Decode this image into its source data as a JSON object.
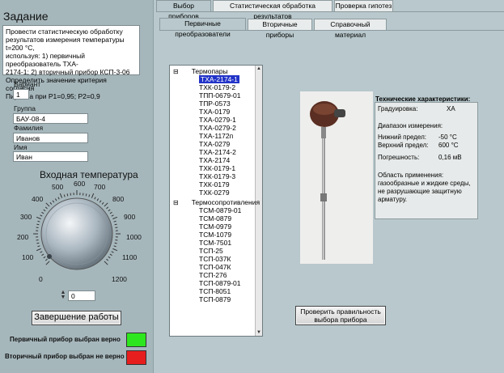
{
  "left": {
    "task_title": "Задание",
    "task_text": "Провести статистическую обработку\nрезультатов измерения температуры t=200 °С,\nиспользуя: 1) первичный преобразователь ТХА-\n2174-1; 2) вторичный прибор КСП-3-06\nОпределить значение критерия согласия\nПирсона при Р1=0,95; Р2=0,9",
    "variant_label": "Вариант",
    "variant_value": "1",
    "group_label": "Группа",
    "group_value": "БАУ-08-4",
    "surname_label": "Фамилия",
    "surname_value": "Иванов",
    "name_label": "Имя",
    "name_value": "Иван",
    "knob_title": "Входная температура",
    "knob_ticks": [
      "0",
      "100",
      "200",
      "300",
      "400",
      "500",
      "600",
      "700",
      "800",
      "900",
      "1000",
      "1100",
      "1200"
    ],
    "knob_value": "0",
    "finish_button": "Завершение работы",
    "status1": "Первичный прибор выбран верно",
    "status1_color": "#2ee61e",
    "status2": "Вторичный прибор выбран не верно",
    "status2_color": "#e61e1e"
  },
  "tabs": [
    "Выбор приборов",
    "Статистическая обработка результатов",
    "Проверка гипотез"
  ],
  "subtabs": [
    "Первичные преобразователи",
    "Вторичные приборы",
    "Справочный материал"
  ],
  "tree": {
    "group1": "Термопары",
    "group1_items": [
      "ТХА-2174-1",
      "ТХК-0179-2",
      "ТПП-0679-01",
      "ТПР-0573",
      "ТХА-0179",
      "ТХА-0279-1",
      "ТХА-0279-2",
      "ТХА-1172п",
      "ТХА-0279",
      "ТХА-2174-2",
      "ТХА-2174",
      "ТХК-0179-1",
      "ТХК-0179-3",
      "ТХК-0179",
      "ТХК-0279"
    ],
    "group2": "Термосопротивления",
    "group2_items": [
      "ТСМ-0879-01",
      "ТСМ-0879",
      "ТСМ-0979",
      "ТСМ-1079",
      "ТСМ-7501",
      "ТСП-25",
      "ТСП-037К",
      "ТСП-047К",
      "ТСП-276",
      "ТСП-0879-01",
      "ТСП-8051",
      "ТСП-0879"
    ]
  },
  "specs": {
    "title": "Технические характеристики:",
    "grad_label": "Градуировка:",
    "grad_value": "ХА",
    "range_label": "Диапазон измерения:",
    "low_label": "Нижний предел:",
    "low_value": "-50 °С",
    "high_label": "Верхний предел:",
    "high_value": "600 °С",
    "err_label": "Погрешность:",
    "err_value": "0,16 мВ",
    "app_text": "Область применения:\nгазообразные и жидкие среды,\nне разрушающие защитную\nарматуру."
  },
  "check_button": "Проверить правильность\nвыбора прибора"
}
